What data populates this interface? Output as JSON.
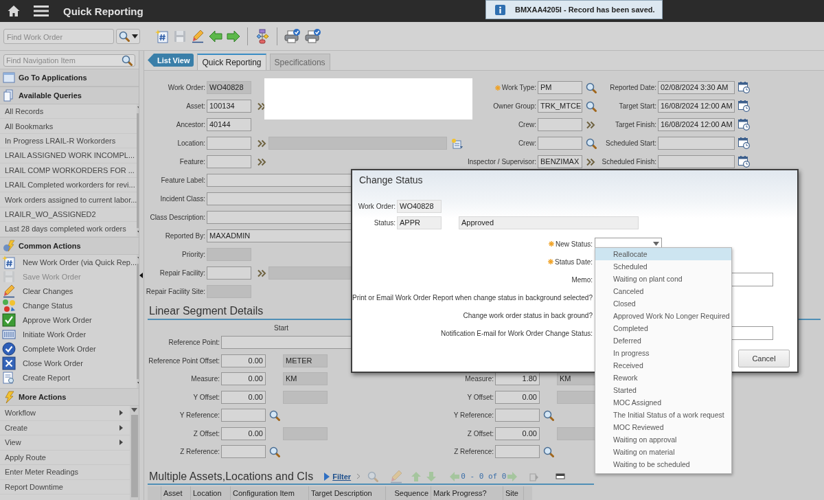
{
  "top_bar": {
    "title": "Quick Reporting"
  },
  "toast": {
    "message": "BMXAA4205I - Record has been saved."
  },
  "toolbar": {
    "find_field": {
      "placeholder": "Find Work Order"
    }
  },
  "sidebar": {
    "search": {
      "placeholder": "Find Navigation Item"
    },
    "go_to_applications": "Go To Applications",
    "queries": {
      "title": "Available Queries",
      "items": [
        "All Records",
        "All Bookmarks",
        "In Progress LRAIL-R Workorders",
        "LRAIL ASSIGNED WORK INCOMPL...",
        "LRAIL COMP WORKORDERS FOR ...",
        "LRAIL Completed workorders for revi...",
        "Work orders assigned to current labor...",
        "LRAILR_WO_ASSIGNED2",
        "Last 28 days completed work orders"
      ]
    },
    "common_actions": {
      "title": "Common Actions",
      "items": [
        {
          "label": "New Work Order (via Quick Rep...",
          "disabled": false
        },
        {
          "label": "Save Work Order",
          "disabled": true
        },
        {
          "label": "Clear Changes",
          "disabled": false
        },
        {
          "label": "Change Status",
          "disabled": false
        },
        {
          "label": "Approve Work Order",
          "disabled": false
        },
        {
          "label": "Initiate Work Order",
          "disabled": false
        },
        {
          "label": "Complete Work Order",
          "disabled": false
        },
        {
          "label": "Close Work Order",
          "disabled": false
        },
        {
          "label": "Create Report",
          "disabled": false
        }
      ]
    },
    "more_actions": {
      "title": "More Actions",
      "items": [
        {
          "label": "Workflow",
          "submenu": true
        },
        {
          "label": "Create",
          "submenu": true
        },
        {
          "label": "View",
          "submenu": true
        },
        {
          "label": "Apply Route",
          "submenu": false
        },
        {
          "label": "Enter Meter Readings",
          "submenu": false
        },
        {
          "label": "Report Downtime",
          "submenu": false
        }
      ]
    }
  },
  "list_view_button": "List View",
  "tabs": [
    {
      "label": "Quick Reporting",
      "selected": true
    },
    {
      "label": "Specifications",
      "selected": false
    }
  ],
  "form": {
    "column_1": [
      {
        "label": "Work Order:",
        "value": "WO40828",
        "kind": "short",
        "readonly": true
      },
      {
        "label": "Asset:",
        "value": "100134",
        "kind": "short",
        "readonly": false,
        "trailing": {
          "kind": "menu"
        }
      },
      {
        "label": "Ancestor:",
        "value": "40144",
        "kind": "short",
        "readonly": false
      },
      {
        "label": "Location:",
        "kind": "with-description",
        "readonly": false,
        "trailing": {
          "kind": "menu"
        },
        "detail_button": true
      },
      {
        "label": "Feature:",
        "kind": "short",
        "readonly": false,
        "trailing": {
          "kind": "menu"
        }
      },
      {
        "label": "Feature Label:",
        "kind": "wide",
        "readonly": false
      },
      {
        "label": "Incident Class:",
        "kind": "wide",
        "readonly": false
      },
      {
        "label": "Class Description:",
        "kind": "wide",
        "readonly": false
      },
      {
        "label": "Reported By:",
        "value": "MAXADMIN",
        "kind": "wide",
        "readonly": false
      },
      {
        "label": "Priority:",
        "kind": "short",
        "readonly": true
      },
      {
        "label": "Repair Facility:",
        "kind": "with-description",
        "readonly": false,
        "trailing": {
          "kind": "menu"
        },
        "detail_button": false
      },
      {
        "label": "Repair Facility Site:",
        "kind": "short",
        "readonly": true
      }
    ],
    "column_2": [
      {
        "label": "Work Type:",
        "value": "PM",
        "required": true,
        "trailing": {
          "kind": "lookup"
        }
      },
      {
        "label": "Owner Group:",
        "value": "TRK_MTCE",
        "required": false,
        "trailing": {
          "kind": "lookup"
        }
      },
      {
        "label": "Crew:",
        "required": false,
        "trailing": {
          "kind": "menu"
        }
      },
      {
        "label": "Crew:",
        "required": false,
        "trailing": {
          "kind": "lookup"
        }
      },
      {
        "label": "Inspector / Supervisor:",
        "value": "BENZIMAX",
        "required": false,
        "trailing": {
          "kind": "menu"
        }
      }
    ],
    "column_3": [
      {
        "label": "Reported Date:",
        "value": "02/08/2024 3:30 AM",
        "trailing": {
          "kind": "calendar"
        }
      },
      {
        "label": "Target Start:",
        "value": "16/08/2024 12:00 AM",
        "trailing": {
          "kind": "calendar"
        }
      },
      {
        "label": "Target Finish:",
        "value": "16/08/2024 12:00 AM",
        "trailing": {
          "kind": "calendar"
        }
      },
      {
        "label": "Scheduled Start:",
        "trailing": {
          "kind": "calendar"
        }
      },
      {
        "label": "Scheduled Finish:",
        "trailing": {
          "kind": "calendar"
        }
      }
    ]
  },
  "linear_segment": {
    "title": "Linear Segment Details",
    "start_heading": "Start",
    "reference_point_label": "Reference Point:",
    "start": [
      {
        "label": "Reference Point Offset:",
        "value": "0.00",
        "kind": "unit",
        "unit": "METER"
      },
      {
        "label": "Measure:",
        "value": "0.00",
        "kind": "unit",
        "unit": "KM"
      },
      {
        "label": "Y Offset:",
        "value": "0.00",
        "kind": "unit"
      },
      {
        "label": "Y Reference:",
        "kind": "lookup"
      },
      {
        "label": "Z Offset:",
        "value": "0.00",
        "kind": "unit"
      },
      {
        "label": "Z Reference:",
        "kind": "lookup"
      }
    ],
    "end": [
      {
        "label": "Measure:",
        "value": "1.80",
        "kind": "unit",
        "unit": "KM"
      },
      {
        "label": "Y Offset:",
        "value": "0.00",
        "kind": "unit"
      },
      {
        "label": "Y Reference:",
        "kind": "lookup"
      },
      {
        "label": "Z Offset:",
        "value": "0.00",
        "kind": "unit"
      },
      {
        "label": "Z Reference:",
        "kind": "lookup"
      }
    ]
  },
  "multiple_assets": {
    "title": "Multiple Assets,Locations and CIs",
    "filter": "Filter",
    "pager": "0 - 0 of 0",
    "columns": [
      "Asset",
      "Location",
      "Configuration Item",
      "Target Description",
      "Sequence",
      "Mark Progress?",
      "Site"
    ]
  },
  "dialog": {
    "title": "Change Status",
    "work_order": {
      "label": "Work Order:",
      "value": "WO40828"
    },
    "status": {
      "label": "Status:",
      "value": "APPR",
      "description": "Approved"
    },
    "fields": [
      {
        "label": "New Status:",
        "required": true,
        "kind": "select"
      },
      {
        "label": "Status Date:",
        "required": true,
        "kind": "label"
      },
      {
        "label": "Memo:",
        "required": false,
        "kind": "text"
      },
      {
        "label": "Print or Email Work Order Report when change status in background selected?",
        "required": false,
        "kind": "label"
      },
      {
        "label": "Change work order status in back ground?",
        "required": false,
        "kind": "label"
      },
      {
        "label": "Notification E-mail for Work Order Change Status:",
        "required": false,
        "kind": "text"
      }
    ],
    "buttons": [
      "Cancel"
    ]
  },
  "dropdown": {
    "options": [
      {
        "label": "Reallocate",
        "selected": true
      },
      {
        "label": "Scheduled",
        "selected": false
      },
      {
        "label": "Waiting on plant cond",
        "selected": false
      },
      {
        "label": "Canceled",
        "selected": false
      },
      {
        "label": "Closed",
        "selected": false
      },
      {
        "label": "Approved Work No Longer Required",
        "selected": false
      },
      {
        "label": "Completed",
        "selected": false
      },
      {
        "label": "Deferred",
        "selected": false
      },
      {
        "label": "In progress",
        "selected": false
      },
      {
        "label": "Received",
        "selected": false
      },
      {
        "label": "Rework",
        "selected": false
      },
      {
        "label": "Started",
        "selected": false
      },
      {
        "label": "MOC Assigned",
        "selected": false
      },
      {
        "label": "The Initial Status of a work request",
        "selected": false
      },
      {
        "label": "MOC Reviewed",
        "selected": false
      },
      {
        "label": "Waiting on approval",
        "selected": false
      },
      {
        "label": "Waiting on material",
        "selected": false
      },
      {
        "label": "Waiting to be scheduled",
        "selected": false
      }
    ]
  }
}
